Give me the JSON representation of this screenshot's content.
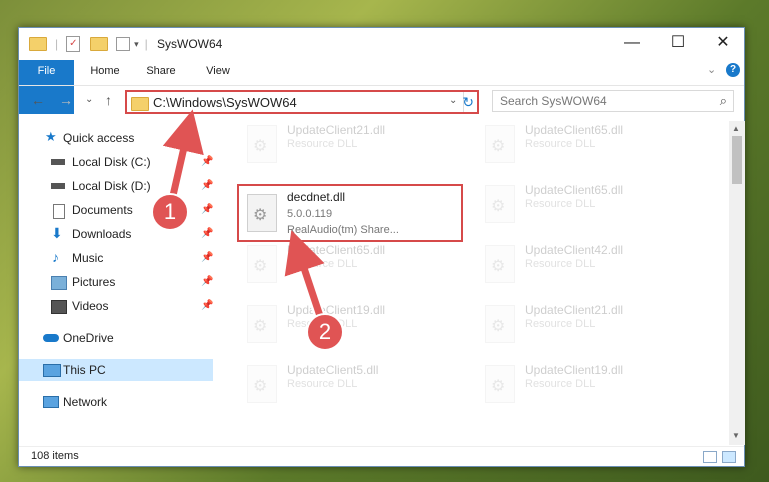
{
  "window": {
    "title": "SysWOW64",
    "minimize": "—",
    "maximize": "☐",
    "close": "✕"
  },
  "ribbon": {
    "tabs": [
      "File",
      "Home",
      "Share",
      "View"
    ],
    "collapse": "⌄",
    "help": "?"
  },
  "nav": {
    "back": "←",
    "forward": "→",
    "recent": "⌄",
    "up": "↑",
    "address": "C:\\Windows\\SysWOW64",
    "address_dropdown": "⌄",
    "refresh": "↻",
    "search_placeholder": "Search SysWOW64",
    "search_icon": "⌕"
  },
  "sidebar": {
    "items": [
      {
        "label": "Quick access",
        "icon": "star-icon"
      },
      {
        "label": "Local Disk (C:)",
        "icon": "drive-icon"
      },
      {
        "label": "Local Disk (D:)",
        "icon": "drive-icon"
      },
      {
        "label": "Documents",
        "icon": "documents-icon"
      },
      {
        "label": "Downloads",
        "icon": "downloads-icon"
      },
      {
        "label": "Music",
        "icon": "music-icon"
      },
      {
        "label": "Pictures",
        "icon": "pictures-icon"
      },
      {
        "label": "Videos",
        "icon": "videos-icon"
      },
      {
        "label": "OneDrive",
        "icon": "cloud-icon"
      },
      {
        "label": "This PC",
        "icon": "pc-icon"
      },
      {
        "label": "Network",
        "icon": "network-icon"
      }
    ],
    "pin": "📌"
  },
  "files": {
    "left": [
      {
        "name": "UpdateClient21.dll",
        "type": "Resource DLL"
      },
      {
        "name": "decdnet.dll",
        "version": "5.0.0.119",
        "company": "RealAudio(tm) Share..."
      },
      {
        "name": "UpdateClient65.dll",
        "type": "Resource DLL"
      },
      {
        "name": "UpdateClient19.dll",
        "type": "Resource DLL"
      },
      {
        "name": "UpdateClient5.dll",
        "type": "Resource DLL"
      }
    ],
    "right": [
      {
        "name": "UpdateClient65.dll",
        "type": "Resource DLL"
      },
      {
        "name": "UpdateClient65.dll",
        "type": "Resource DLL"
      },
      {
        "name": "UpdateClient42.dll",
        "type": "Resource DLL"
      },
      {
        "name": "UpdateClient21.dll",
        "type": "Resource DLL"
      },
      {
        "name": "UpdateClient19.dll",
        "type": "Resource DLL"
      }
    ]
  },
  "status": {
    "count": "108 items"
  },
  "annotations": {
    "badge1": "1",
    "badge2": "2",
    "accent": "#e05454"
  }
}
